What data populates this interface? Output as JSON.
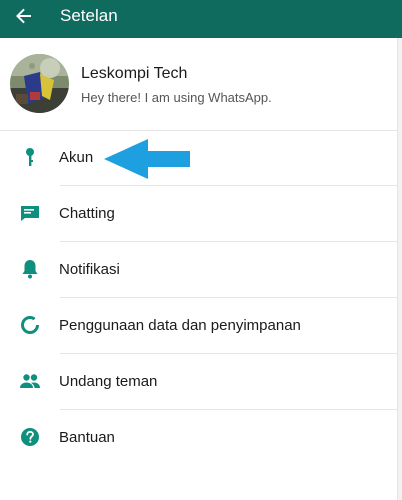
{
  "toolbar": {
    "title": "Setelan",
    "back_icon": "arrow-back-icon",
    "background": "#0f6b5e"
  },
  "profile": {
    "name": "Leskompi Tech",
    "status": "Hey there! I am using WhatsApp."
  },
  "menu": {
    "items": [
      {
        "label": "Akun",
        "icon": "key-icon"
      },
      {
        "label": "Chatting",
        "icon": "chat-icon"
      },
      {
        "label": "Notifikasi",
        "icon": "bell-icon"
      },
      {
        "label": "Penggunaan data dan penyimpanan",
        "icon": "data-usage-icon"
      },
      {
        "label": "Undang teman",
        "icon": "people-icon"
      },
      {
        "label": "Bantuan",
        "icon": "help-icon"
      }
    ]
  },
  "colors": {
    "accent": "#0f8f7e",
    "annotation_arrow": "#1ea0e0"
  }
}
